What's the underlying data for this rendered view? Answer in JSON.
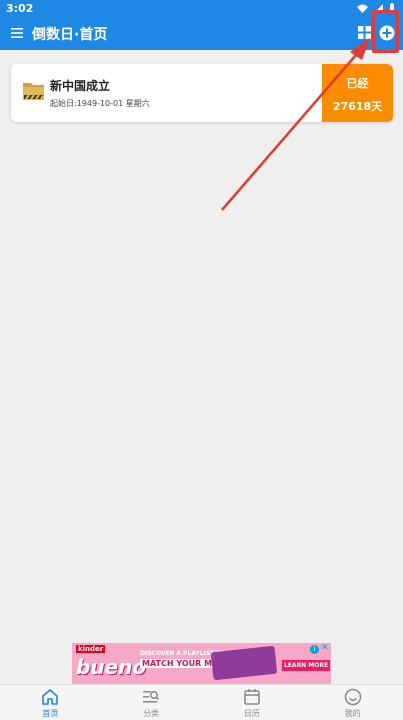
{
  "status_bar": {
    "time": "3:02"
  },
  "app_bar": {
    "title": "倒数日·首页"
  },
  "events": [
    {
      "name": "新中国成立",
      "start_text": "起始日:1949-10-01 星期六",
      "badge_label": "已经",
      "badge_days": "27618天"
    }
  ],
  "ad": {
    "brand": "kinder",
    "product": "bueno",
    "tagline_1": "DISCOVER A PLAYLIST TO",
    "tagline_2": "MATCH YOUR MOOD",
    "cta": "LEARN MORE"
  },
  "tabs": [
    {
      "label": "首页",
      "icon": "home-icon",
      "active": true
    },
    {
      "label": "分类",
      "icon": "category-search-icon",
      "active": false
    },
    {
      "label": "日历",
      "icon": "calendar-icon",
      "active": false
    },
    {
      "label": "我的",
      "icon": "smile-profile-icon",
      "active": false
    }
  ],
  "colors": {
    "primary": "#1e88e5",
    "badge": "#fb8c00",
    "highlight": "#e53935"
  }
}
